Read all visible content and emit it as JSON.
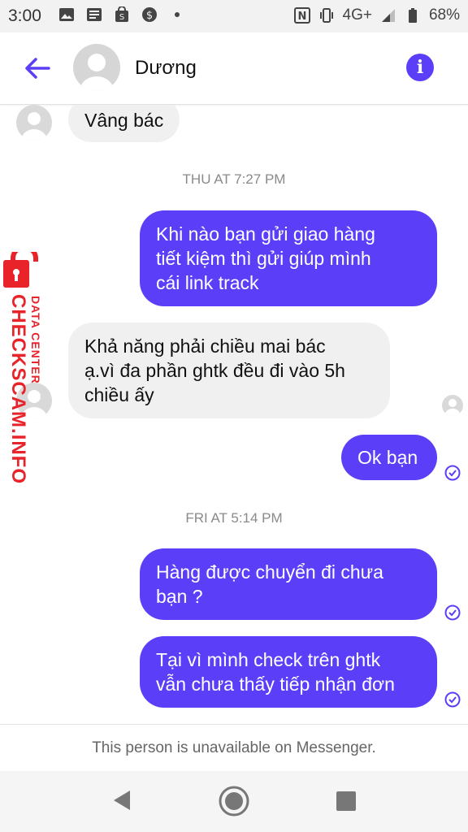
{
  "status_bar": {
    "time": "3:00",
    "network": "4G+",
    "battery": "68%",
    "icons": [
      "image-icon",
      "news-icon",
      "shop-icon",
      "currency-icon",
      "dot-icon",
      "nfc-icon",
      "vibrate-icon",
      "signal-icon",
      "battery-icon"
    ]
  },
  "header": {
    "contact_name": "Dương",
    "back_icon": "arrow-left-icon",
    "info_icon": "info-icon",
    "accent": "#5b3ff8"
  },
  "messages": [
    {
      "side": "in",
      "text": "Vâng bác"
    },
    {
      "timestamp": "THU AT 7:27 PM"
    },
    {
      "side": "out",
      "lines": [
        "Khi nào bạn gửi giao hàng",
        "tiết kiệm thì gửi giúp mình",
        "cái link track"
      ]
    },
    {
      "side": "in",
      "lines": [
        "Khả năng phải chiều mai bác",
        "ạ.vì đa phần ghtk đều đi vào 5h",
        "chiều ấy"
      ]
    },
    {
      "side": "out",
      "text": "Ok bạn"
    },
    {
      "timestamp": "FRI AT 5:14 PM"
    },
    {
      "side": "out",
      "lines": [
        "Hàng được chuyển đi chưa",
        "bạn ?"
      ]
    },
    {
      "side": "out",
      "lines": [
        "Tại vì mình check trên ghtk",
        "vẫn chưa thấy tiếp nhận đơn"
      ]
    }
  ],
  "watermark": {
    "brand": "CHECKSCAM.INFO",
    "subtitle": "DATA CENTER",
    "color": "#e8232a"
  },
  "footer": {
    "text": "This person is unavailable on Messenger."
  },
  "nav": {
    "back": "nav-back-icon",
    "home": "nav-home-icon",
    "recents": "nav-recents-icon"
  }
}
